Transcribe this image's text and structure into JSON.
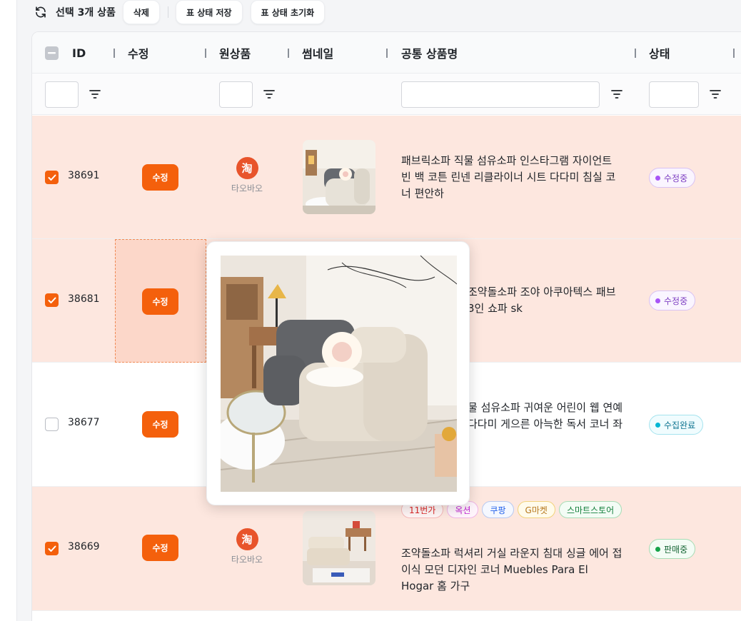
{
  "toolbar": {
    "selection_label": "선택 3개 상품",
    "delete_label": "삭제",
    "save_state_label": "표 상태 저장",
    "reset_state_label": "표 상태 초기화"
  },
  "columns": {
    "id": "ID",
    "edit": "수정",
    "source": "원상품",
    "thumbnail": "썸네일",
    "name": "공통 상품명",
    "status": "상태"
  },
  "rows": [
    {
      "id": "38691",
      "checked": true,
      "edit_label": "수정",
      "source_icon": "淘",
      "source_label": "타오바오",
      "name": "패브릭소파 직물 섬유소파 인스타그램 자이언트 빈 백 코튼 린넨 리클라이너 시트 다다미 침실 코너 편안하",
      "status": "수정중"
    },
    {
      "id": "38681",
      "checked": true,
      "edit_label": "수정",
      "name": "조약돌소파 조야 아쿠아텍스 패브 3인 쇼파 sk",
      "status": "수정중"
    },
    {
      "id": "38677",
      "checked": false,
      "edit_label": "수정",
      "name": "물 섬유소파 귀여운 어린이 웹 연예 다다미 게으른 아늑한 독서 코너 좌",
      "status": "수집완료"
    },
    {
      "id": "38669",
      "checked": true,
      "edit_label": "수정",
      "source_icon": "淘",
      "source_label": "타오바오",
      "tags": [
        "11번가",
        "옥션",
        "쿠팡",
        "G마켓",
        "스마트스토어"
      ],
      "name": "조약돌소파 럭셔리 거실 라운지 침대 싱글 에어 접이식 모던 디자인 코너 Muebles Para El Hogar 홈 가구",
      "status": "판매중"
    }
  ],
  "colors": {
    "accent": "#f4600c",
    "selected_row": "#fde7df",
    "status_editing": "#a855f7",
    "status_collected": "#06b6d4",
    "status_selling": "#16a34a"
  }
}
